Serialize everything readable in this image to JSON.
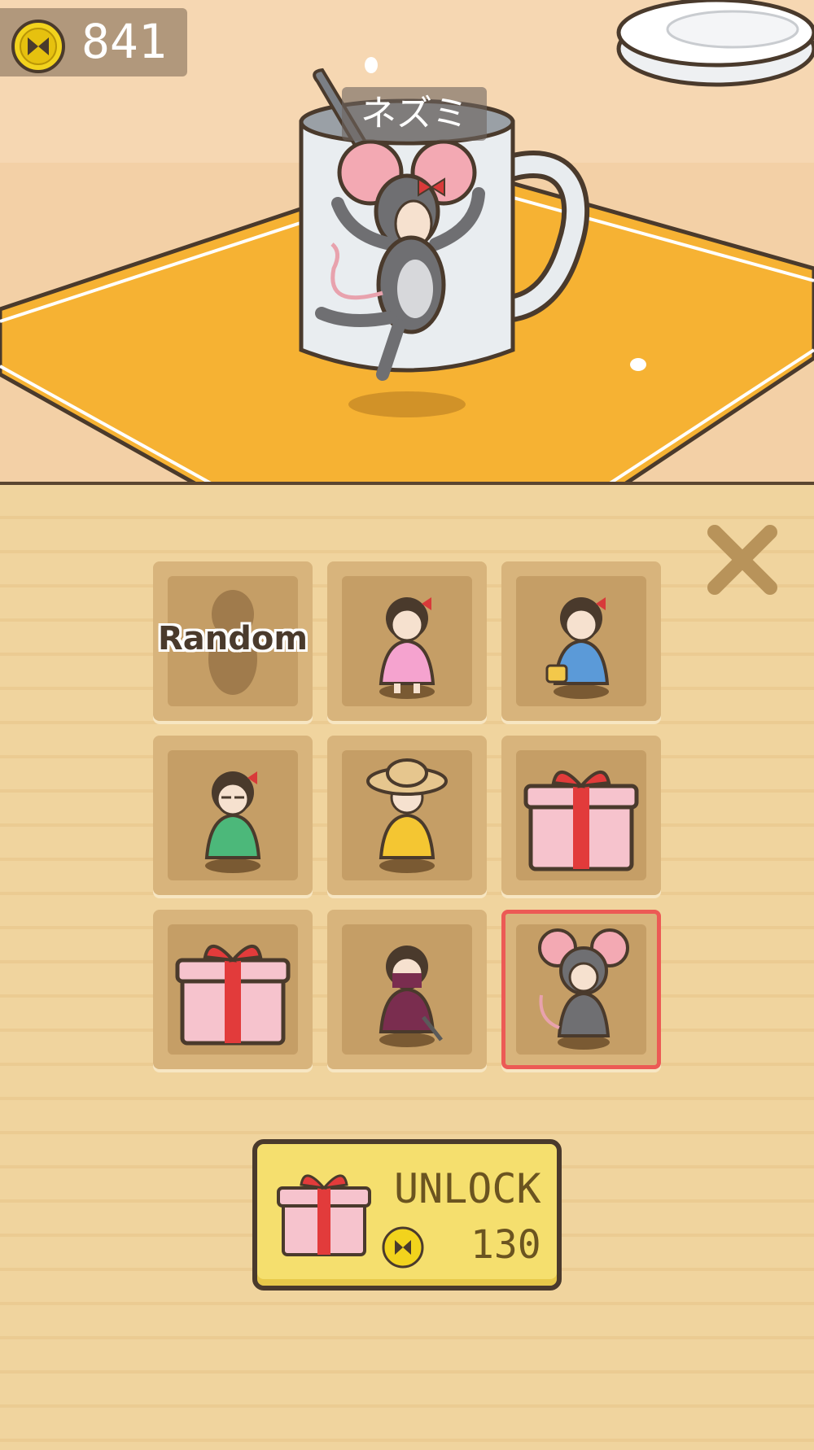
{
  "hud": {
    "coins": "841"
  },
  "scene": {
    "character_name": "ネズミ"
  },
  "selector": {
    "random_label": "Random",
    "slots": [
      {
        "kind": "random"
      },
      {
        "kind": "character",
        "outfit": "pink-dress"
      },
      {
        "kind": "character",
        "outfit": "blue-dress"
      },
      {
        "kind": "character",
        "outfit": "green-dress-glasses"
      },
      {
        "kind": "character",
        "outfit": "yellow-dress-sunhat"
      },
      {
        "kind": "locked-gift"
      },
      {
        "kind": "locked-gift"
      },
      {
        "kind": "character",
        "outfit": "ninja"
      },
      {
        "kind": "character",
        "outfit": "mouse-costume",
        "selected": true
      }
    ]
  },
  "unlock": {
    "label": "UNLOCK",
    "price": "130"
  },
  "colors": {
    "tablecloth": "#f6b233",
    "panel": "#f0d49e",
    "selected_border": "#ec5a55",
    "button": "#f5df6e"
  }
}
